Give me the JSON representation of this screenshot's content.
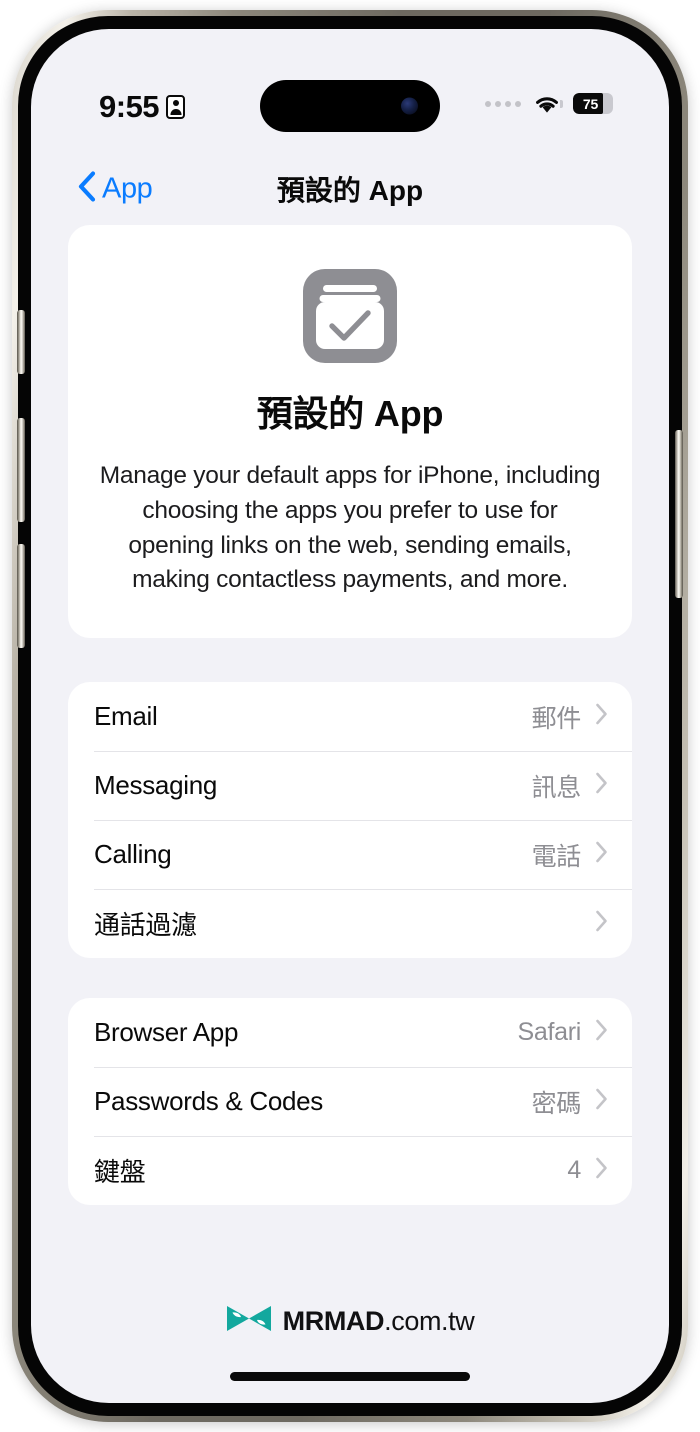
{
  "status_bar": {
    "time": "9:55",
    "badge_icon": "id-badge-icon",
    "signal_icon": "signal-dots-icon",
    "wifi_icon": "wifi-icon",
    "battery_level": "75",
    "battery_percent": 75,
    "battery_icon": "battery-icon"
  },
  "nav": {
    "back_label": "App",
    "back_icon": "chevron-left-icon",
    "title": "預設的 App"
  },
  "hero": {
    "icon_name": "default-apps-icon",
    "title": "預設的 App",
    "description": "Manage your default apps for iPhone, including choosing the apps you prefer to use for opening links on the web, sending emails, making contactless payments, and more."
  },
  "groups": [
    {
      "name": "communication-group",
      "rows": [
        {
          "label": "Email",
          "value": "郵件",
          "chevron": "chevron-right-icon"
        },
        {
          "label": "Messaging",
          "value": "訊息",
          "chevron": "chevron-right-icon"
        },
        {
          "label": "Calling",
          "value": "電話",
          "chevron": "chevron-right-icon"
        },
        {
          "label": "通話過濾",
          "value": "",
          "chevron": "chevron-right-icon"
        }
      ]
    },
    {
      "name": "browser-passwords-group",
      "rows": [
        {
          "label": "Browser App",
          "value": "Safari",
          "chevron": "chevron-right-icon"
        },
        {
          "label": "Passwords & Codes",
          "value": "密碼",
          "chevron": "chevron-right-icon"
        },
        {
          "label": "鍵盤",
          "value": "4",
          "chevron": "chevron-right-icon"
        }
      ]
    }
  ],
  "watermark": {
    "logo_icon": "mrmad-logo-icon",
    "brand": "MRMAD",
    "domain": ".com.tw"
  },
  "colors": {
    "accent_blue": "#0a7cff",
    "background": "#f2f2f7",
    "card": "#ffffff",
    "secondary_text": "#8e8e93",
    "separator": "#e4e4e8",
    "icon_gray": "#8e8e93",
    "logo_teal": "#13a89e"
  }
}
